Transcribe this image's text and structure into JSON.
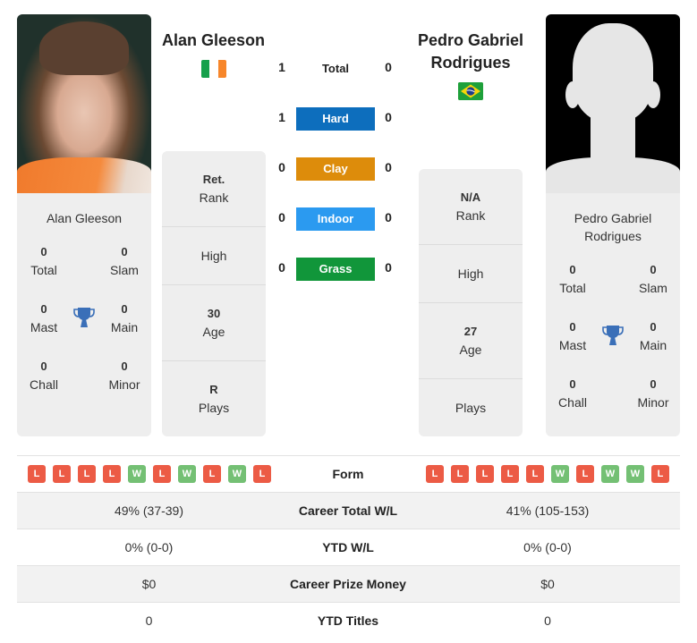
{
  "player1": {
    "name": "Alan Gleeson",
    "flag": "ireland-flag",
    "flag_colors": [
      "#16a04b",
      "#ffffff",
      "#f7862a"
    ],
    "titles": {
      "total": {
        "value": "0",
        "label": "Total"
      },
      "slam": {
        "value": "0",
        "label": "Slam"
      },
      "mast": {
        "value": "0",
        "label": "Mast"
      },
      "main": {
        "value": "0",
        "label": "Main"
      },
      "chall": {
        "value": "0",
        "label": "Chall"
      },
      "minor": {
        "value": "0",
        "label": "Minor"
      }
    },
    "info": {
      "rank": {
        "value": "Ret.",
        "label": "Rank"
      },
      "high": {
        "value": "",
        "label": "High"
      },
      "age": {
        "value": "30",
        "label": "Age"
      },
      "plays": {
        "value": "R",
        "label": "Plays"
      }
    },
    "form": [
      "L",
      "L",
      "L",
      "L",
      "W",
      "L",
      "W",
      "L",
      "W",
      "L"
    ]
  },
  "player2": {
    "name": "Pedro Gabriel Rodrigues",
    "name_line1": "Pedro Gabriel",
    "name_line2": "Rodrigues",
    "flag": "brazil-flag",
    "flag_colors": [
      "#1ea03a",
      "#f5d60a",
      "#1f3c88"
    ],
    "titles": {
      "total": {
        "value": "0",
        "label": "Total"
      },
      "slam": {
        "value": "0",
        "label": "Slam"
      },
      "mast": {
        "value": "0",
        "label": "Mast"
      },
      "main": {
        "value": "0",
        "label": "Main"
      },
      "chall": {
        "value": "0",
        "label": "Chall"
      },
      "minor": {
        "value": "0",
        "label": "Minor"
      }
    },
    "info": {
      "rank": {
        "value": "N/A",
        "label": "Rank"
      },
      "high": {
        "value": "",
        "label": "High"
      },
      "age": {
        "value": "27",
        "label": "Age"
      },
      "plays": {
        "value": "",
        "label": "Plays"
      }
    },
    "form": [
      "L",
      "L",
      "L",
      "L",
      "L",
      "W",
      "L",
      "W",
      "W",
      "L"
    ]
  },
  "h2h": {
    "total": {
      "label": "Total",
      "p1": "1",
      "p2": "0"
    },
    "surfaces": [
      {
        "label": "Hard",
        "p1": "1",
        "p2": "0",
        "color": "#0d6ebd"
      },
      {
        "label": "Clay",
        "p1": "0",
        "p2": "0",
        "color": "#dd8c0b"
      },
      {
        "label": "Indoor",
        "p1": "0",
        "p2": "0",
        "color": "#2b9af0"
      },
      {
        "label": "Grass",
        "p1": "0",
        "p2": "0",
        "color": "#11963a"
      }
    ]
  },
  "comparison": {
    "form_label": "Form",
    "rows": [
      {
        "label": "Career Total W/L",
        "p1": "49% (37-39)",
        "p2": "41% (105-153)"
      },
      {
        "label": "YTD W/L",
        "p1": "0% (0-0)",
        "p2": "0% (0-0)"
      },
      {
        "label": "Career Prize Money",
        "p1": "$0",
        "p2": "$0"
      },
      {
        "label": "YTD Titles",
        "p1": "0",
        "p2": "0"
      }
    ]
  },
  "colors": {
    "loss": "#ec5b45",
    "win": "#74c074",
    "trophy": "#3a6fb8",
    "card_bg": "#eeeeee"
  }
}
